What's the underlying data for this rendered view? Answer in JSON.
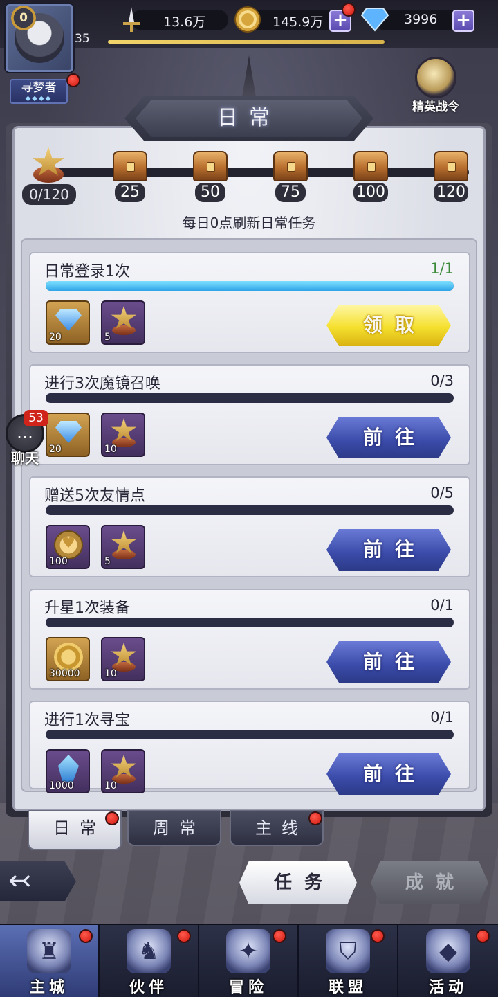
{
  "player": {
    "level_badge": "0",
    "level": "35",
    "exp_fraction": 0.99,
    "title": "寻梦者",
    "title_dots": "◆◆◆◆"
  },
  "resources": [
    {
      "icon": "sword-power-icon",
      "value": "13.6万"
    },
    {
      "icon": "gold-coin-icon",
      "value": "145.9万"
    },
    {
      "icon": "diamond-icon",
      "value": "3996"
    }
  ],
  "elite_pass": {
    "label": "精英战令"
  },
  "panel": {
    "title": "日常"
  },
  "activity": {
    "points": "0/120",
    "milestones": [
      "25",
      "50",
      "75",
      "100",
      "120"
    ],
    "refresh_note": "每日0点刷新日常任务"
  },
  "tasks": [
    {
      "name": "日常登录1次",
      "progress": "1/1",
      "fraction": 1.0,
      "rewards": [
        {
          "type": "diamond",
          "count": "20"
        },
        {
          "type": "activity-star",
          "count": "5"
        }
      ],
      "button": "领取",
      "button_style": "claim"
    },
    {
      "name": "进行3次魔镜召唤",
      "progress": "0/3",
      "fraction": 0,
      "rewards": [
        {
          "type": "diamond",
          "count": "20"
        },
        {
          "type": "activity-star",
          "count": "10"
        }
      ],
      "button": "前往",
      "button_style": "go"
    },
    {
      "name": "赠送5次友情点",
      "progress": "0/5",
      "fraction": 0,
      "rewards": [
        {
          "type": "friendship-coin",
          "count": "100"
        },
        {
          "type": "activity-star",
          "count": "5"
        }
      ],
      "button": "前往",
      "button_style": "go"
    },
    {
      "name": "升星1次装备",
      "progress": "0/1",
      "fraction": 0,
      "rewards": [
        {
          "type": "gold-coin",
          "count": "30000"
        },
        {
          "type": "activity-star",
          "count": "10"
        }
      ],
      "button": "前往",
      "button_style": "go"
    },
    {
      "name": "进行1次寻宝",
      "progress": "0/1",
      "fraction": 0,
      "rewards": [
        {
          "type": "crystal",
          "count": "1000"
        },
        {
          "type": "activity-star",
          "count": "10"
        }
      ],
      "button": "前往",
      "button_style": "go"
    }
  ],
  "chat": {
    "label": "聊天",
    "count": "53"
  },
  "subtabs": [
    {
      "label": "日常",
      "active": true
    },
    {
      "label": "周常",
      "active": false
    },
    {
      "label": "主线",
      "active": false
    }
  ],
  "modes": [
    {
      "label": "任务",
      "active": true
    },
    {
      "label": "成就",
      "active": false
    }
  ],
  "bottom_nav": [
    {
      "label": "主城",
      "icon": "castle-icon",
      "active": true
    },
    {
      "label": "伙伴",
      "icon": "companion-icon",
      "active": false
    },
    {
      "label": "冒险",
      "icon": "compass-icon",
      "active": false
    },
    {
      "label": "联盟",
      "icon": "shield-icon",
      "active": false
    },
    {
      "label": "活动",
      "icon": "cards-icon",
      "active": false
    }
  ],
  "colors": {
    "accent_blue": "#3a4aa8",
    "claim_yellow": "#f5e02e",
    "progress_cyan": "#2fa6e8",
    "notify_red": "#d0180f"
  }
}
